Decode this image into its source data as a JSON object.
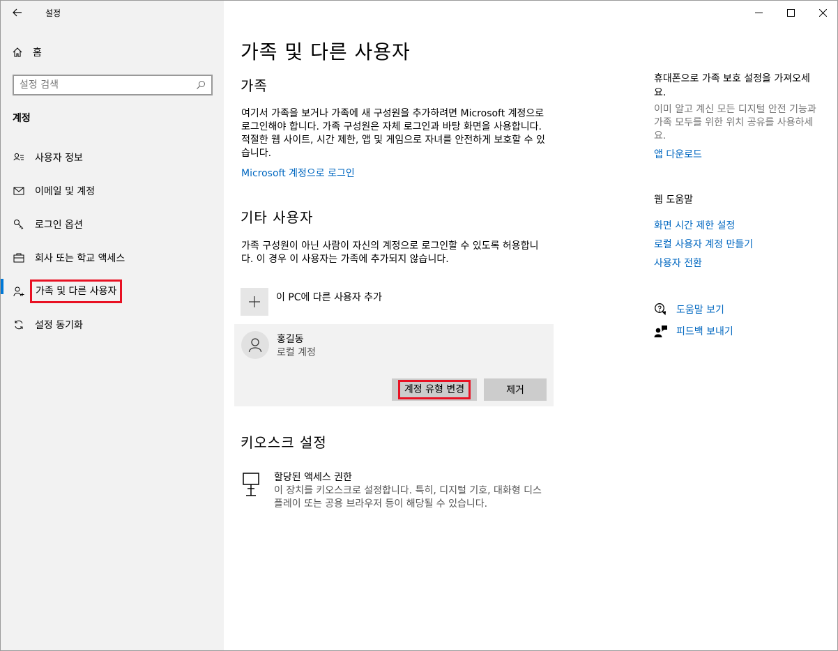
{
  "window": {
    "title": "설정"
  },
  "sidebar": {
    "home_label": "홈",
    "search_placeholder": "설정 검색",
    "section_label": "계정",
    "items": [
      {
        "label": "사용자 정보",
        "icon": "user-info-icon"
      },
      {
        "label": "이메일 및 계정",
        "icon": "mail-icon"
      },
      {
        "label": "로그인 옵션",
        "icon": "key-icon"
      },
      {
        "label": "회사 또는 학교 액세스",
        "icon": "briefcase-icon"
      },
      {
        "label": "가족 및 다른 사용자",
        "icon": "user-add-icon",
        "active": true
      },
      {
        "label": "설정 동기화",
        "icon": "sync-icon"
      }
    ]
  },
  "main": {
    "title": "가족 및 다른 사용자",
    "family": {
      "heading": "가족",
      "description": "여기서 가족을 보거나 가족에 새 구성원을 추가하려면 Microsoft 계정으로 로그인해야 합니다. 가족 구성원은 자체 로그인과 바탕 화면을 사용합니다. 적절한 웹 사이트, 시간 제한, 앱 및 게임으로 자녀를 안전하게 보호할 수 있습니다.",
      "link": "Microsoft 계정으로 로그인"
    },
    "other_users": {
      "heading": "기타 사용자",
      "description": "가족 구성원이 아닌 사람이 자신의 계정으로 로그인할 수 있도록 허용합니다. 이 경우 이 사용자는 가족에 추가되지 않습니다.",
      "add_label": "이 PC에 다른 사용자 추가",
      "user": {
        "name": "홍길동",
        "type": "로컬 계정",
        "change_button": "계정 유형 변경",
        "remove_button": "제거"
      }
    },
    "kiosk": {
      "heading": "키오스크 설정",
      "title": "할당된 액세스 권한",
      "description": "이 장치를 키오스크로 설정합니다. 특히, 디지털 기호, 대화형 디스플레이 또는 공용 브라우저 등이 해당될 수 있습니다."
    }
  },
  "right": {
    "mobile_heading": "휴대폰으로 가족 보호 설정을 가져오세요.",
    "mobile_desc": "이미 알고 계신 모든 디지털 안전 기능과 가족 모두를 위한 위치 공유를 사용하세요.",
    "app_download": "앱 다운로드",
    "web_help_heading": "웹 도움말",
    "links": [
      "화면 시간 제한 설정",
      "로컬 사용자 계정 만들기",
      "사용자 전환"
    ],
    "help": "도움말 보기",
    "feedback": "피드백 보내기"
  },
  "colors": {
    "accent": "#0078d7",
    "link": "#0067c0",
    "highlight": "#e81123"
  }
}
